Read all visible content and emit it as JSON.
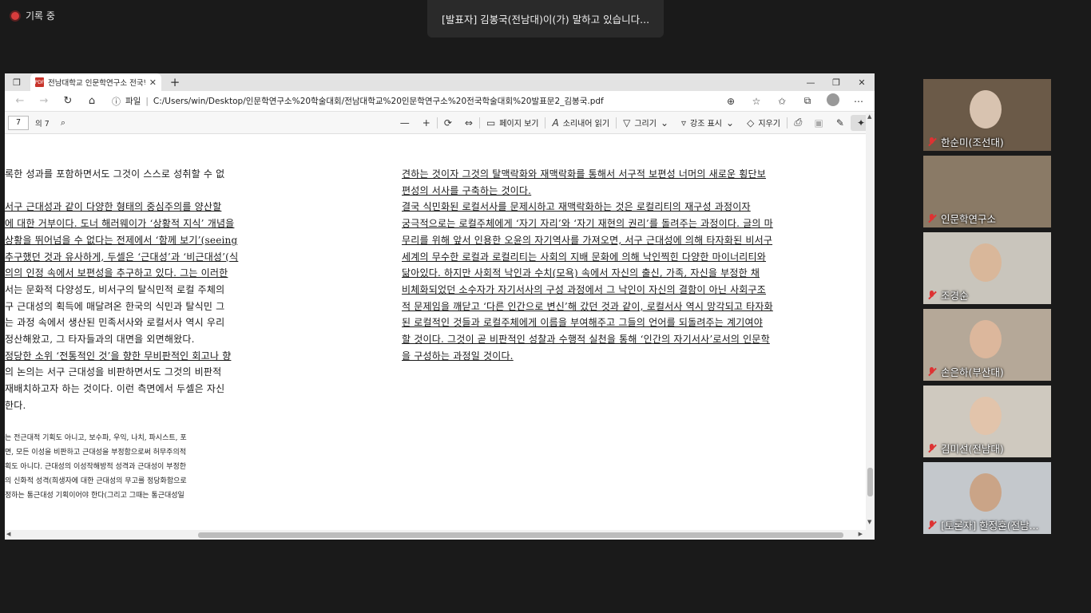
{
  "recording": {
    "label": "기록 중"
  },
  "speaker_banner": {
    "text": "[발표자] 김봉국(전남대)이(가) 말하고 있습니다..."
  },
  "browser": {
    "tab": {
      "title": "전남대학교 인문학연구소 전국학술대회",
      "close": "✕"
    },
    "new_tab": "+",
    "window_controls": {
      "minimize": "—",
      "maximize": "❐",
      "close": "✕"
    },
    "address": {
      "scheme_label": "파일",
      "url": "C:/Users/win/Desktop/인문학연구소%20학술대회/전남대학교%20인문학연구소%20전국학술대회%20발표문2_김봉국.pdf"
    }
  },
  "pdf_toolbar": {
    "page_number": "7",
    "page_total": "의 7",
    "page_view": "페이지 보기",
    "read_aloud": "소리내어 읽기",
    "draw": "그리기",
    "highlight": "강조 표시",
    "erase": "지우기"
  },
  "document": {
    "left_lines": [
      {
        "text": "록한 성과를 포함하면서도 그것이 스스로 성취할 수 없",
        "u": false
      },
      {
        "text": "",
        "u": false
      },
      {
        "text": " 서구 근대성과 같이 다양한 형태의 중심주의를 양산할",
        "u": true
      },
      {
        "text": "에 대한 거부이다. 도너 해러웨이가 ‘상황적 지식’ 개념을",
        "u": true
      },
      {
        "text": "상황을 뛰어넘을 수 없다는 전제에서 ‘함께 보기’(seeing",
        "u": true
      },
      {
        "text": "추구했던 것과 유사하게, 두셀은 ‘근대성’과 ‘비근대성’(식",
        "u": true
      },
      {
        "text": "의의 인정 속에서 보편성을 추구하고 있다. 그는 이러한",
        "u": true
      },
      {
        "text": "서는 문화적 다양성도, 비서구의 탈식민적 로컬 주체의",
        "u": false
      },
      {
        "text": "구 근대성의 획득에 매달려온 한국의 식민과 탈식민 그",
        "u": false
      },
      {
        "text": "는 과정 속에서 생산된 민족서사와 로컬서사 역시 우리",
        "u": false
      },
      {
        "text": "정산해왔고, 그 타자들과의 대면을 외면해왔다.",
        "u": false
      },
      {
        "text": "정당한 소위 ‘전통적인 것’을 향한 무비판적인 회고나 향",
        "u": true
      },
      {
        "text": "의 논의는 서구 근대성을 비판하면서도 그것의 비판적",
        "u": false
      },
      {
        "text": " 재배치하고자 하는 것이다. 이런 측면에서 두셀은 자신",
        "u": false
      },
      {
        "text": "한다.",
        "u": false
      }
    ],
    "footnote_lines": [
      "는 전근대적 기획도 아니고, 보수파, 우익, 나치, 파시스트, 포",
      "면, 모든 이성을 비판하고 근대성을 부정함으로써 허무주의적",
      "획도 아니다. 근대성의 이성작해방적 성격과 근대성이 부정한",
      "의 신화적 성격(희생자에 대한 근대성의 무고를 정당화함으로",
      "정하는 통근대성 기획이어야 한다(그리고 그때는 통근대성일"
    ],
    "right_lines": [
      "견하는 것이자 그것의 탈맥락화와 재맥락화를 통해서 서구적 보편성 너머의 새로운 횡단보",
      "편성의 서사를 구축하는 것이다.",
      "    결국 식민화된 로컬서사를 문제시하고 재맥락화하는 것은 로컬리티의 재구성 과정이자",
      "궁극적으로는 로컬주체에게 ‘자기 자리’와 ‘자기 재현의 권리’를 돌려주는 과정이다. 글의 마",
      "무리를 위해 앞서 인용한 오윤의 자기역사를 가져오면, 서구 근대성에 의해 타자화된 비서구",
      "세계의 무수한 로컬과 로컬리티는 사회의 지배 문화에 의해 낙인찍힌 다양한 마이너리티와",
      "닮아있다. 하지만 사회적 낙인과 수치(모욕) 속에서 자신의 출신, 가족, 자신을 부정한 채",
      "비체화되었던 소수자가 자기서사의 구성 과정에서 그 낙인이 자신의 결함이 아닌 사회구조",
      "적 문제임을 깨닫고 ‘다른 인간으로 변신’해 갔던 것과 같이, 로컬서사 역시 망각되고 타자화",
      "된 로컬적인 것들과 로컬주체에게 이름을 부여해주고 그들의 언어를 되돌려주는 계기여야",
      "할 것이다. 그것이 곧 비판적인 성찰과 수행적 실천을 통해 ‘인간의 자기서사’로서의 인문학",
      "을 구성하는 과정일 것이다."
    ]
  },
  "participants": [
    {
      "name": "한순미(조선대)",
      "bg": "#6b5a48",
      "face": "#d8c3b0"
    },
    {
      "name": "인문학연구소",
      "bg": "#8a7a66",
      "face": ""
    },
    {
      "name": "조경순",
      "bg": "#c9c5bc",
      "face": "#d9b79a"
    },
    {
      "name": "손은하(부산대)",
      "bg": "#b5a898",
      "face": "#dcb79c"
    },
    {
      "name": "김미선(전남대)",
      "bg": "#cfc9bf",
      "face": "#e2c4ab"
    },
    {
      "name": "[토론자] 한정훈(전남...",
      "bg": "#c4c8cc",
      "face": "#caa487"
    }
  ]
}
